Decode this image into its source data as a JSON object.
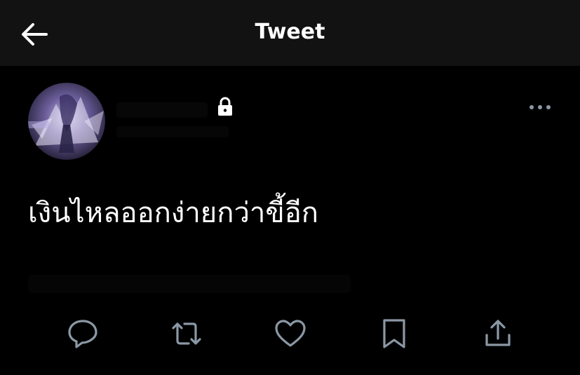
{
  "header": {
    "title": "Tweet",
    "back_icon": "arrow-left-icon"
  },
  "tweet": {
    "text": "เงินไหลออกง่ายกว่าขี้อีก",
    "account_protected_icon": "lock-icon",
    "more_icon": "more-horizontal-icon"
  },
  "actions": [
    {
      "name": "reply",
      "icon": "reply-icon"
    },
    {
      "name": "retweet",
      "icon": "retweet-icon"
    },
    {
      "name": "like",
      "icon": "heart-icon"
    },
    {
      "name": "bookmark",
      "icon": "bookmark-icon"
    },
    {
      "name": "share",
      "icon": "share-icon"
    }
  ],
  "colors": {
    "background": "#000000",
    "topbar": "#121212",
    "text": "#ffffff",
    "icon": "#8b98a5"
  }
}
